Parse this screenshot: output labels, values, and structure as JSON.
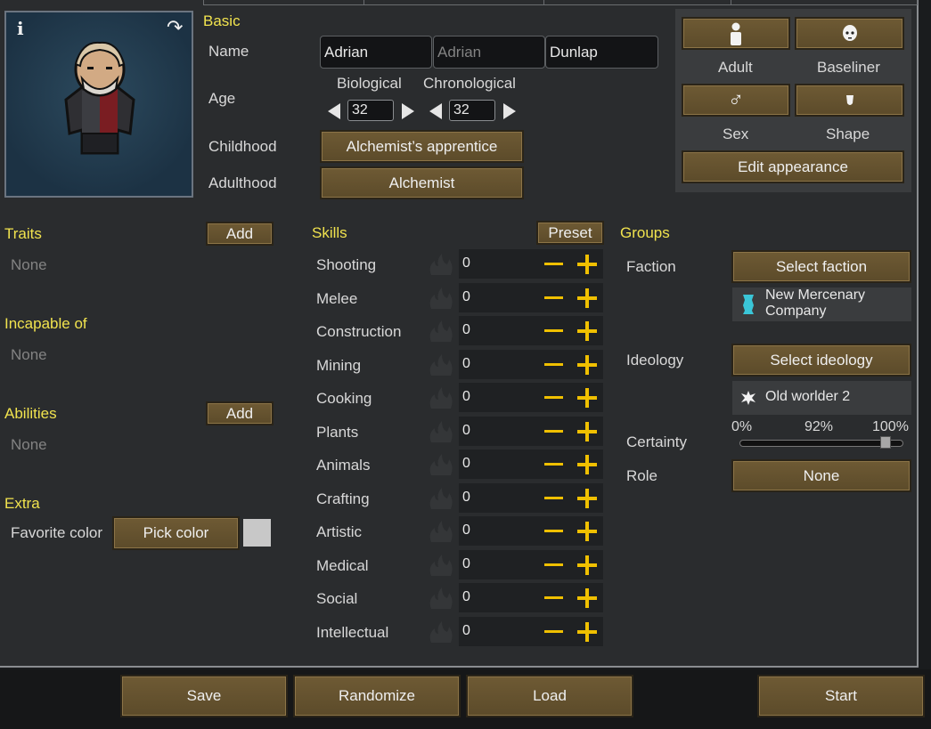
{
  "basic": {
    "header": "Basic",
    "name_label": "Name",
    "first_name": "Adrian",
    "nickname_placeholder": "Adrian",
    "last_name": "Dunlap",
    "age_label": "Age",
    "biological_label": "Biological",
    "chronological_label": "Chronological",
    "biological_age": "32",
    "chronological_age": "32",
    "childhood_label": "Childhood",
    "childhood_value": "Alchemist’s apprentice",
    "adulthood_label": "Adulthood",
    "adulthood_value": "Alchemist"
  },
  "appearance": {
    "adult_label": "Adult",
    "baseliner_label": "Baseliner",
    "sex_label": "Sex",
    "shape_label": "Shape",
    "edit_appearance": "Edit appearance"
  },
  "traits": {
    "header": "Traits",
    "add": "Add",
    "value": "None"
  },
  "incapable": {
    "header": "Incapable of",
    "value": "None"
  },
  "abilities": {
    "header": "Abilities",
    "add": "Add",
    "value": "None"
  },
  "extra": {
    "header": "Extra",
    "favorite_color_label": "Favorite color",
    "pick_color": "Pick color",
    "swatch_color": "#c8c8c8"
  },
  "skills": {
    "header": "Skills",
    "preset": "Preset",
    "items": [
      {
        "name": "Shooting",
        "value": "0"
      },
      {
        "name": "Melee",
        "value": "0"
      },
      {
        "name": "Construction",
        "value": "0"
      },
      {
        "name": "Mining",
        "value": "0"
      },
      {
        "name": "Cooking",
        "value": "0"
      },
      {
        "name": "Plants",
        "value": "0"
      },
      {
        "name": "Animals",
        "value": "0"
      },
      {
        "name": "Crafting",
        "value": "0"
      },
      {
        "name": "Artistic",
        "value": "0"
      },
      {
        "name": "Medical",
        "value": "0"
      },
      {
        "name": "Social",
        "value": "0"
      },
      {
        "name": "Intellectual",
        "value": "0"
      }
    ]
  },
  "groups": {
    "header": "Groups",
    "faction_label": "Faction",
    "select_faction": "Select faction",
    "faction_name": "New Mercenary Company",
    "ideology_label": "Ideology",
    "select_ideology": "Select ideology",
    "ideology_name": "Old worlder 2",
    "certainty_label": "Certainty",
    "certainty_min": "0%",
    "certainty_current": "92%",
    "certainty_max": "100%",
    "certainty_value": 0.92,
    "role_label": "Role",
    "role_value": "None"
  },
  "bottom": {
    "save": "Save",
    "randomize": "Randomize",
    "load": "Load",
    "start": "Start"
  },
  "colors": {
    "accent": "#f1e34e",
    "button": "#6e5a34",
    "panel": "#2a2c2e",
    "faction_icon": "#3ac6d8"
  }
}
